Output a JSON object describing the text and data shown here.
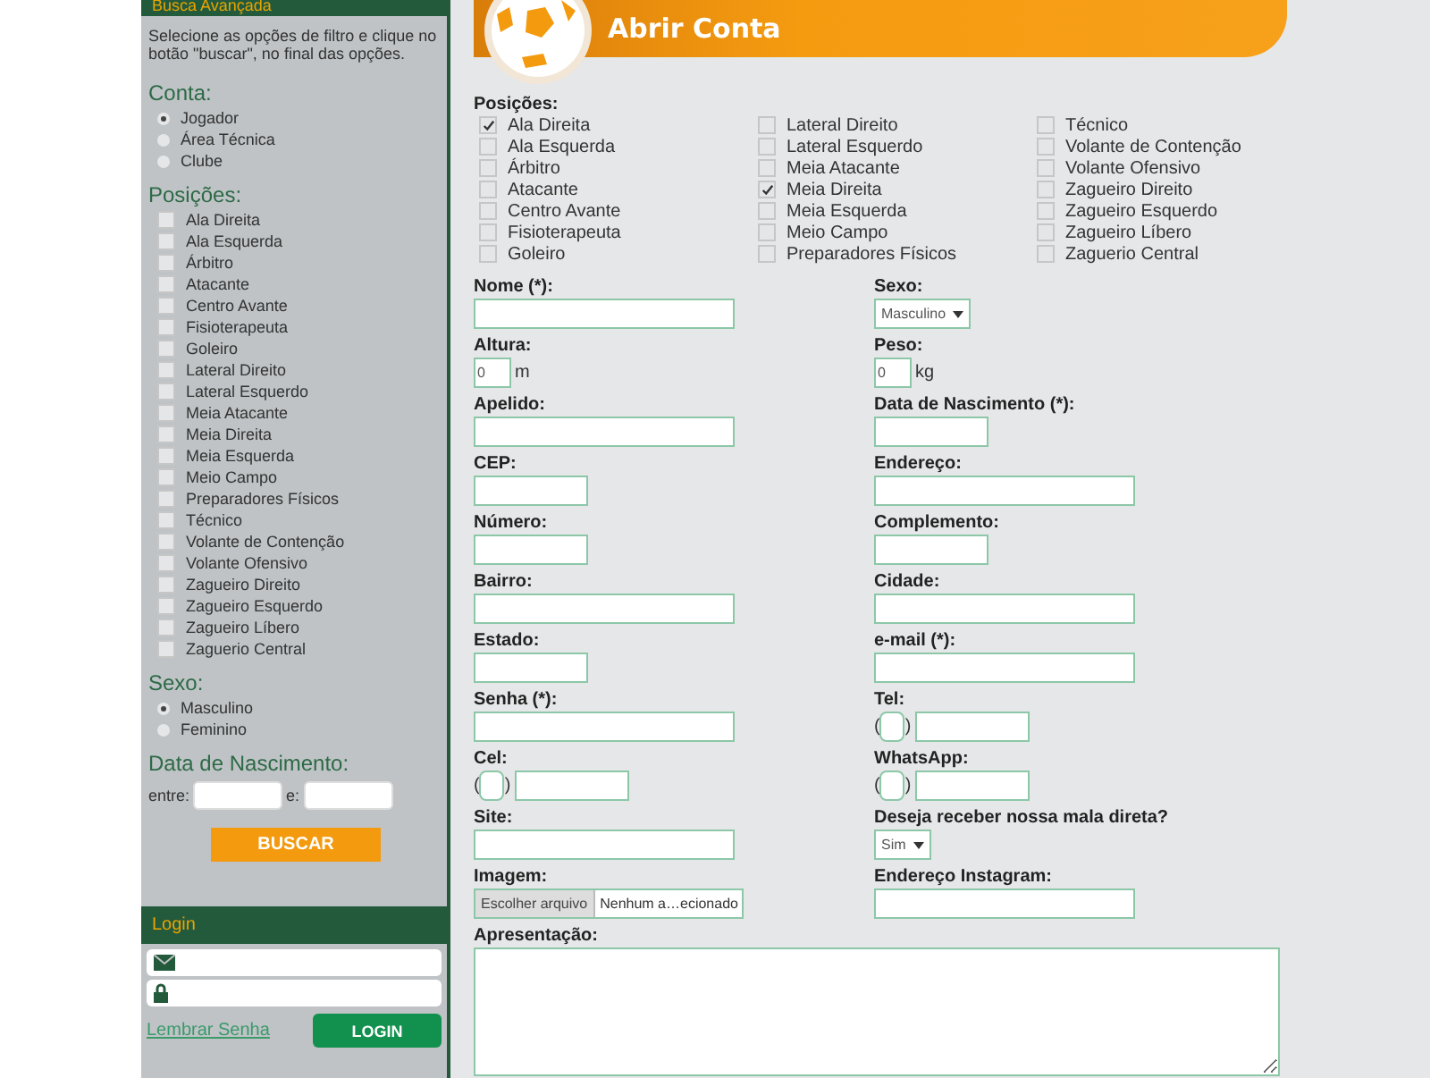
{
  "sidebar": {
    "header": "Busca Avançada",
    "intro": "Selecione as opções de filtro e clique no botão \"buscar\", no final das opções.",
    "account": {
      "title": "Conta:",
      "options": [
        {
          "label": "Jogador",
          "selected": true
        },
        {
          "label": "Área Técnica",
          "selected": false
        },
        {
          "label": "Clube",
          "selected": false
        }
      ]
    },
    "positions": {
      "title": "Posições:",
      "options": [
        {
          "label": "Ala Direita",
          "checked": false
        },
        {
          "label": "Ala Esquerda",
          "checked": false
        },
        {
          "label": "Árbitro",
          "checked": false
        },
        {
          "label": "Atacante",
          "checked": false
        },
        {
          "label": "Centro Avante",
          "checked": false
        },
        {
          "label": "Fisioterapeuta",
          "checked": false
        },
        {
          "label": "Goleiro",
          "checked": false
        },
        {
          "label": "Lateral Direito",
          "checked": false
        },
        {
          "label": "Lateral Esquerdo",
          "checked": false
        },
        {
          "label": "Meia Atacante",
          "checked": false
        },
        {
          "label": "Meia Direita",
          "checked": false
        },
        {
          "label": "Meia Esquerda",
          "checked": false
        },
        {
          "label": "Meio Campo",
          "checked": false
        },
        {
          "label": "Preparadores Físicos",
          "checked": false
        },
        {
          "label": "Técnico",
          "checked": false
        },
        {
          "label": "Volante de Contenção",
          "checked": false
        },
        {
          "label": "Volante Ofensivo",
          "checked": false
        },
        {
          "label": "Zagueiro Direito",
          "checked": false
        },
        {
          "label": "Zagueiro Esquerdo",
          "checked": false
        },
        {
          "label": "Zagueiro Líbero",
          "checked": false
        },
        {
          "label": "Zaguerio Central",
          "checked": false
        }
      ]
    },
    "sex": {
      "title": "Sexo:",
      "options": [
        {
          "label": "Masculino",
          "selected": true
        },
        {
          "label": "Feminino",
          "selected": false
        }
      ]
    },
    "birth": {
      "title": "Data de Nascimento:",
      "from_label": "entre:",
      "to_label": "e:"
    },
    "search_button": "BUSCAR"
  },
  "login": {
    "title": "Login",
    "forgot_link": "Lembrar Senha",
    "button": "LOGIN"
  },
  "main": {
    "title": "Abrir Conta",
    "positions": {
      "title": "Posições:",
      "columns": [
        [
          {
            "label": "Ala Direita",
            "checked": true
          },
          {
            "label": "Ala Esquerda",
            "checked": false
          },
          {
            "label": "Árbitro",
            "checked": false
          },
          {
            "label": "Atacante",
            "checked": false
          },
          {
            "label": "Centro Avante",
            "checked": false
          },
          {
            "label": "Fisioterapeuta",
            "checked": false
          },
          {
            "label": "Goleiro",
            "checked": false
          }
        ],
        [
          {
            "label": "Lateral Direito",
            "checked": false
          },
          {
            "label": "Lateral Esquerdo",
            "checked": false
          },
          {
            "label": "Meia Atacante",
            "checked": false
          },
          {
            "label": "Meia Direita",
            "checked": true
          },
          {
            "label": "Meia Esquerda",
            "checked": false
          },
          {
            "label": "Meio Campo",
            "checked": false
          },
          {
            "label": "Preparadores Físicos",
            "checked": false
          }
        ],
        [
          {
            "label": "Técnico",
            "checked": false
          },
          {
            "label": "Volante de Contenção",
            "checked": false
          },
          {
            "label": "Volante Ofensivo",
            "checked": false
          },
          {
            "label": "Zagueiro Direito",
            "checked": false
          },
          {
            "label": "Zagueiro Esquerdo",
            "checked": false
          },
          {
            "label": "Zagueiro Líbero",
            "checked": false
          },
          {
            "label": "Zaguerio Central",
            "checked": false
          }
        ]
      ]
    },
    "fields": [
      {
        "label": "Nome (*):",
        "kind": "wide"
      },
      {
        "label": "Sexo:",
        "kind": "select",
        "value": "Masculino"
      },
      {
        "label": "Altura:",
        "kind": "unit",
        "value": "0",
        "unit": "m"
      },
      {
        "label": "Peso:",
        "kind": "unit",
        "value": "0",
        "unit": "kg"
      },
      {
        "label": "Apelido:",
        "kind": "wide"
      },
      {
        "label": "Data de Nascimento (*):",
        "kind": "short"
      },
      {
        "label": "CEP:",
        "kind": "short"
      },
      {
        "label": "Endereço:",
        "kind": "wide"
      },
      {
        "label": "Número:",
        "kind": "short"
      },
      {
        "label": "Complemento:",
        "kind": "short"
      },
      {
        "label": "Bairro:",
        "kind": "wide"
      },
      {
        "label": "Cidade:",
        "kind": "wide"
      },
      {
        "label": "Estado:",
        "kind": "short"
      },
      {
        "label": "e-mail (*):",
        "kind": "wide"
      },
      {
        "label": "Senha (*):",
        "kind": "wide"
      },
      {
        "label": "Tel:",
        "kind": "phone",
        "open": "(",
        "close": ")"
      },
      {
        "label": "Cel:",
        "kind": "phone",
        "open": "(",
        "close": ")"
      },
      {
        "label": "WhatsApp:",
        "kind": "phone",
        "open": "(",
        "close": ")"
      },
      {
        "label": "Site:",
        "kind": "wide"
      },
      {
        "label": "Deseja receber nossa mala direta?",
        "kind": "select",
        "value": "Sim"
      },
      {
        "label": "Imagem:",
        "kind": "file",
        "button": "Escolher arquivo",
        "status": "Nenhum a…ecionado"
      },
      {
        "label": "Endereço Instagram:",
        "kind": "wide"
      }
    ],
    "presentation": {
      "label": "Apresentação:"
    }
  }
}
